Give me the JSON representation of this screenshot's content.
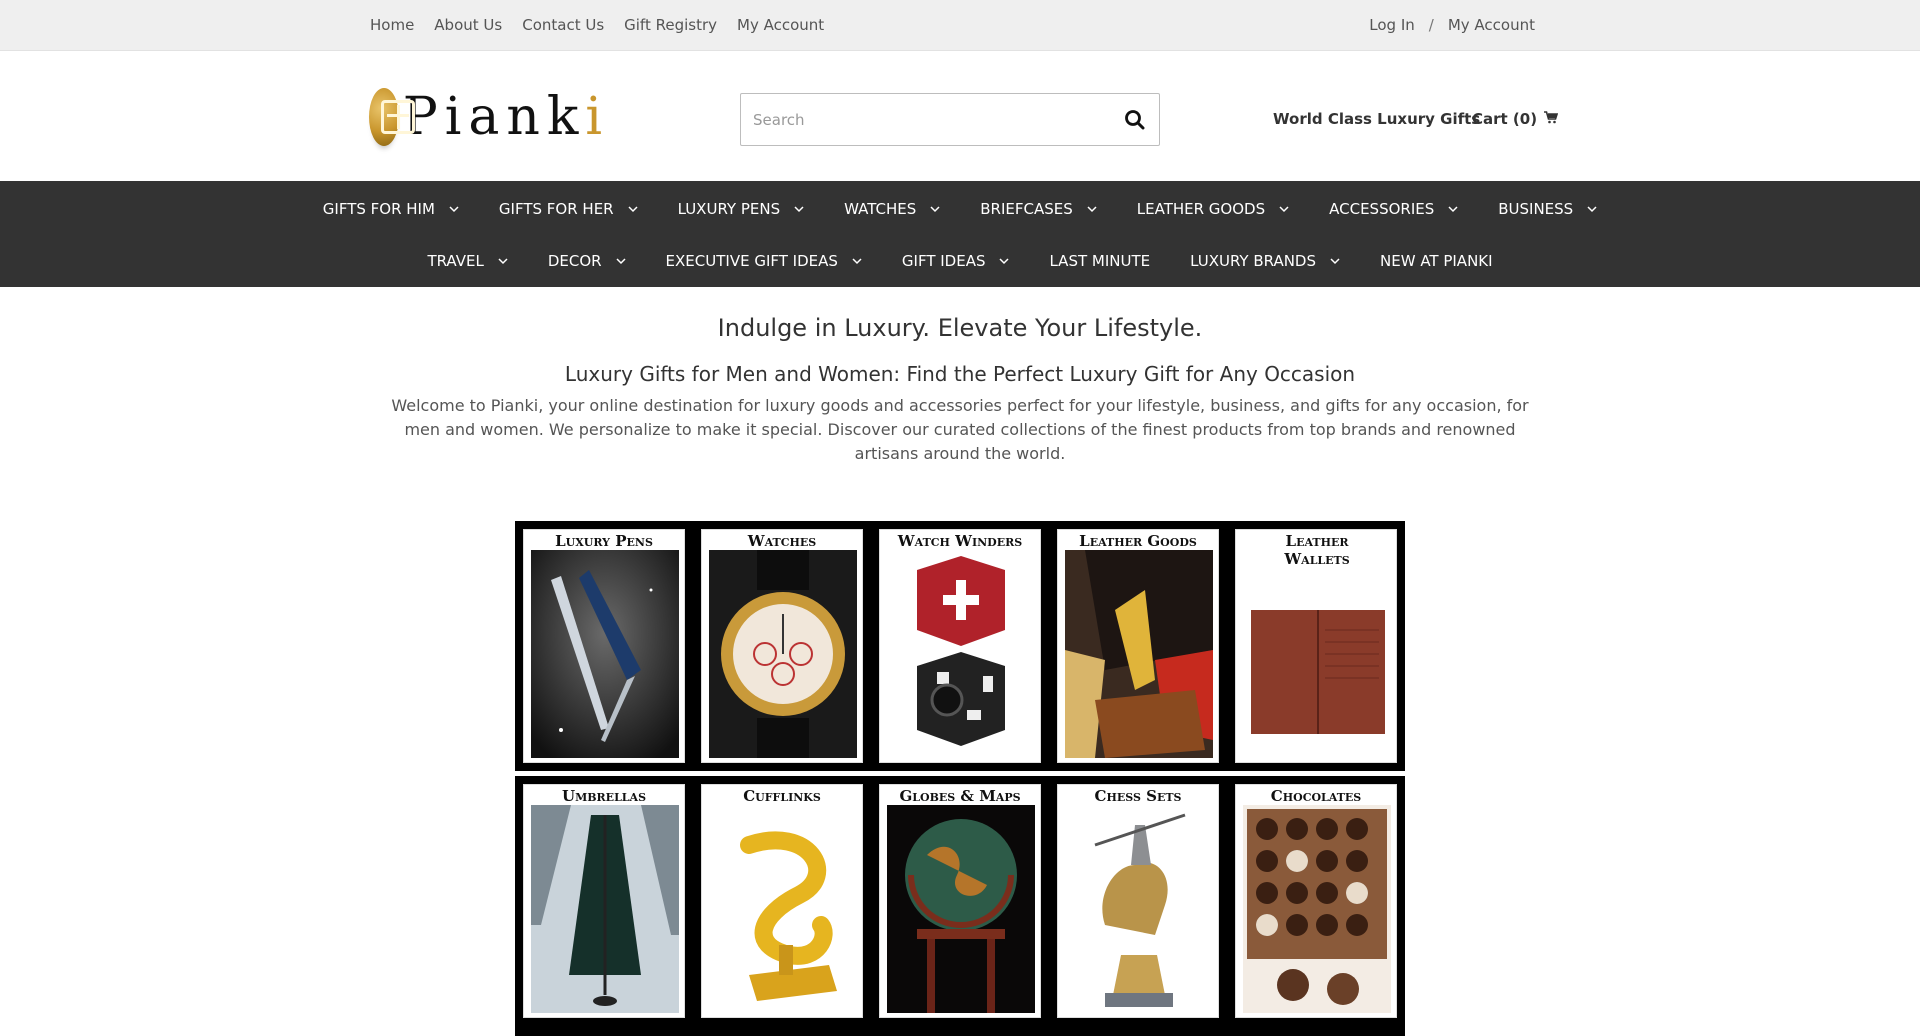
{
  "topbar": {
    "links": [
      "Home",
      "About Us",
      "Contact Us",
      "Gift Registry",
      "My Account"
    ],
    "login": "Log In",
    "separator": "/",
    "account": "My Account"
  },
  "header": {
    "logo_text": "Pianki",
    "search_placeholder": "Search",
    "tagline": "World Class Luxury Gifts",
    "cart_label": "Cart (0)"
  },
  "nav": {
    "row1": [
      {
        "label": "GIFTS FOR HIM",
        "dropdown": true
      },
      {
        "label": "GIFTS FOR HER",
        "dropdown": true
      },
      {
        "label": "LUXURY PENS",
        "dropdown": true
      },
      {
        "label": "WATCHES",
        "dropdown": true
      },
      {
        "label": "BRIEFCASES",
        "dropdown": true
      },
      {
        "label": "LEATHER GOODS",
        "dropdown": true
      },
      {
        "label": "ACCESSORIES",
        "dropdown": true
      },
      {
        "label": "BUSINESS",
        "dropdown": true
      }
    ],
    "row2": [
      {
        "label": "TRAVEL",
        "dropdown": true
      },
      {
        "label": "DECOR",
        "dropdown": true
      },
      {
        "label": "EXECUTIVE GIFT IDEAS",
        "dropdown": true
      },
      {
        "label": "GIFT IDEAS",
        "dropdown": true
      },
      {
        "label": "LAST MINUTE",
        "dropdown": false
      },
      {
        "label": "LUXURY BRANDS",
        "dropdown": true
      },
      {
        "label": "NEW AT PIANKI",
        "dropdown": false
      }
    ]
  },
  "content": {
    "heading": "Indulge in Luxury. Elevate Your Lifestyle.",
    "subheading": "Luxury Gifts for Men and Women: Find the Perfect Luxury Gift for Any Occasion",
    "intro": "Welcome to Pianki, your online destination for luxury goods and accessories perfect for your lifestyle, business, and gifts for any occasion, for men and women. We personalize to make it special. Discover our curated collections of the finest products from top brands and renowned artisans around the world."
  },
  "categories": {
    "row1": [
      "Luxury Pens",
      "Watches",
      "Watch Winders",
      "Leather Goods",
      "Leather Wallets"
    ],
    "row2": [
      "Umbrellas",
      "Cufflinks",
      "Globes & Maps",
      "Chess Sets",
      "Chocolates"
    ]
  },
  "colors": {
    "topbar_bg": "#efefef",
    "nav_bg": "#333333",
    "brand_gold": "#c9962d"
  }
}
